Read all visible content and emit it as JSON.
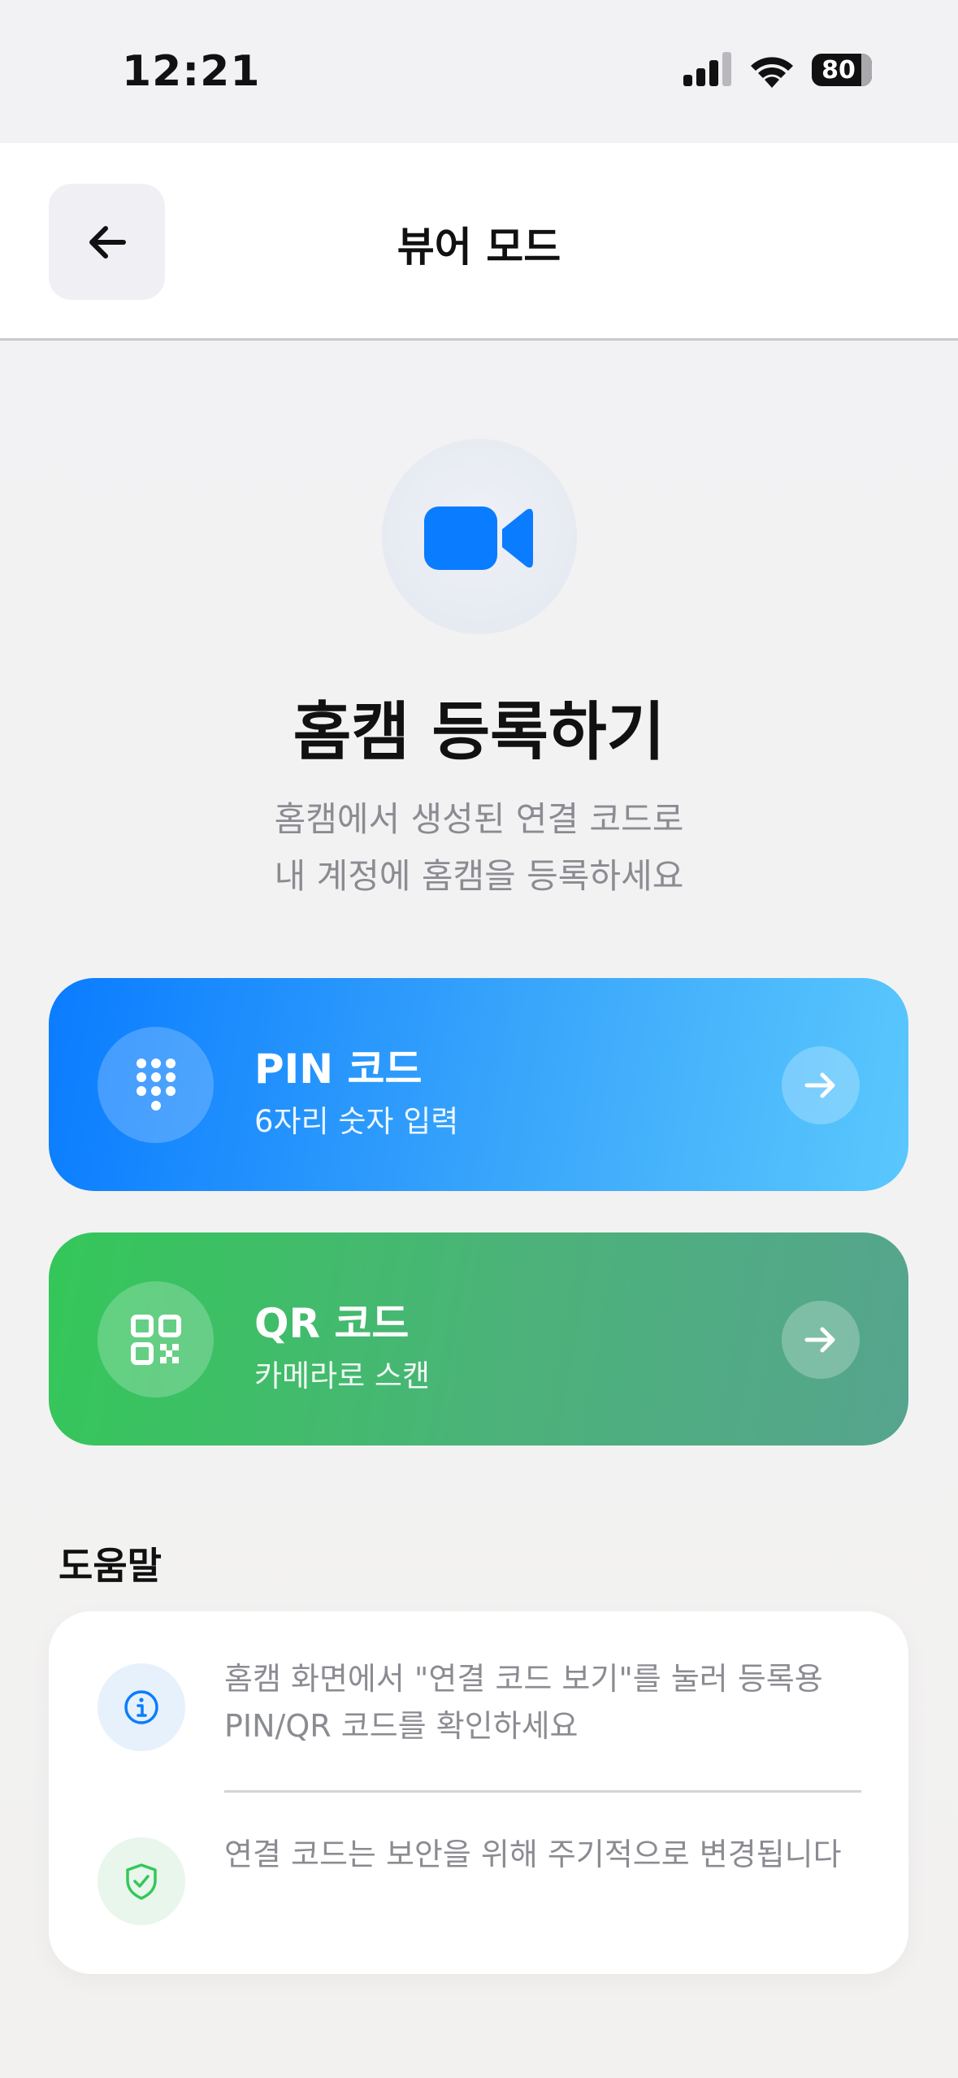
{
  "status_bar": {
    "time": "12:21",
    "battery": "80",
    "icons": [
      "cellular-signal-icon",
      "wifi-icon",
      "battery-icon"
    ]
  },
  "nav": {
    "title": "뷰어 모드",
    "back_icon": "arrow-left-icon"
  },
  "hero": {
    "icon": "video-camera-icon",
    "title": "홈캠 등록하기",
    "subtitle_line1": "홈캠에서 생성된 연결 코드로",
    "subtitle_line2": "내 계정에 홈캠을 등록하세요"
  },
  "options": [
    {
      "title": "PIN 코드",
      "subtitle": "6자리 숫자 입력",
      "icon": "keypad-icon",
      "arrow_icon": "arrow-right-icon"
    },
    {
      "title": "QR 코드",
      "subtitle": "카메라로 스캔",
      "icon": "qr-code-icon",
      "arrow_icon": "arrow-right-icon"
    }
  ],
  "help": {
    "heading": "도움말",
    "items": [
      {
        "icon": "info-icon",
        "line1": "홈캠 화면에서 \"연결 코드 보기\"를 눌러 등록용",
        "line2": "PIN/QR 코드를 확인하세요"
      },
      {
        "icon": "shield-check-icon",
        "line1": "연결 코드는 보안을 위해 주기적으로 변경됩니다"
      }
    ]
  },
  "colors": {
    "accent_blue": "#0A7CFF",
    "accent_green": "#34C759"
  }
}
